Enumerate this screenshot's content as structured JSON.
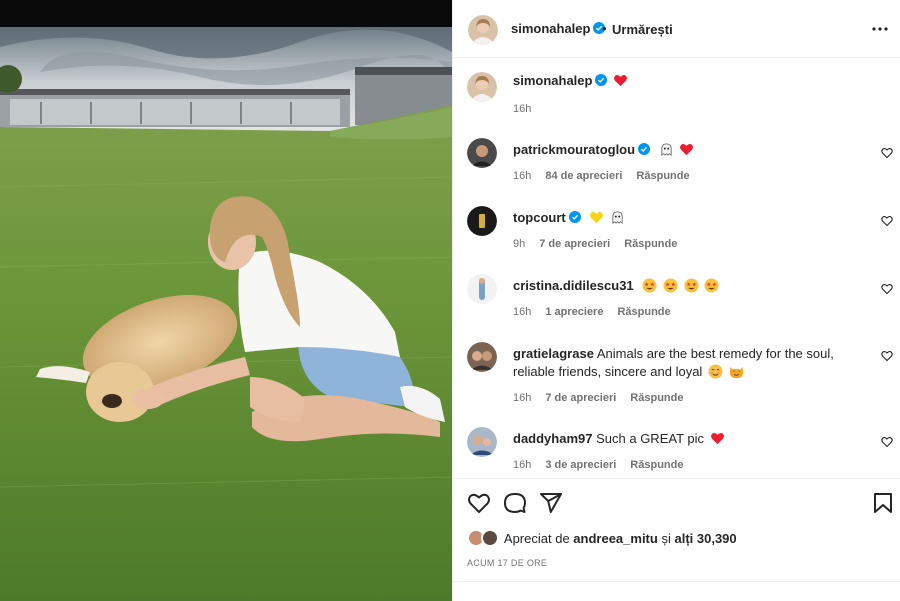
{
  "post": {
    "author": "simonahalep",
    "follow_label": "Urmărești",
    "dot": "•",
    "caption_time": "16h"
  },
  "comments": [
    {
      "user": "patrickmouratoglou",
      "text": "",
      "verified": true,
      "emojis": [
        "ghost",
        "heart"
      ],
      "time": "16h",
      "likes": "84 de aprecieri",
      "reply": "Răspunde"
    },
    {
      "user": "topcourt",
      "text": "",
      "verified": true,
      "emojis": [
        "yellow-heart",
        "ghost"
      ],
      "time": "9h",
      "likes": "7 de aprecieri",
      "reply": "Răspunde"
    },
    {
      "user": "cristina.didilescu31",
      "text": "",
      "verified": false,
      "emojis": [
        "star-eyes",
        "star-eyes",
        "star-eyes",
        "star-eyes"
      ],
      "time": "16h",
      "likes": "1 apreciere",
      "reply": "Răspunde"
    },
    {
      "user": "gratielagrase",
      "text": "Animals are the best remedy for the soul, reliable friends, sincere and loyal",
      "verified": false,
      "emojis": [
        "smile",
        "cat-heart-eyes"
      ],
      "time": "16h",
      "likes": "7 de aprecieri",
      "reply": "Răspunde"
    },
    {
      "user": "daddyham97",
      "text": "Such a GREAT pic",
      "verified": false,
      "emojis": [
        "heart"
      ],
      "time": "16h",
      "likes": "3 de aprecieri",
      "reply": "Răspunde"
    }
  ],
  "likes_summary": {
    "prefix": "Apreciat de",
    "user": "andreea_mitu",
    "suffix": "și",
    "others": "alți 30,390"
  },
  "post_time": "ACUM 17 DE ORE",
  "colors": {
    "verified": "#0095f6",
    "heart": "#ed1c2e",
    "text": "#262626",
    "muted": "#737373",
    "grass": "#5e8a34"
  },
  "icons": [
    "more-icon",
    "like-icon",
    "comment-icon",
    "share-icon",
    "bookmark-icon",
    "heart-outline-icon"
  ]
}
